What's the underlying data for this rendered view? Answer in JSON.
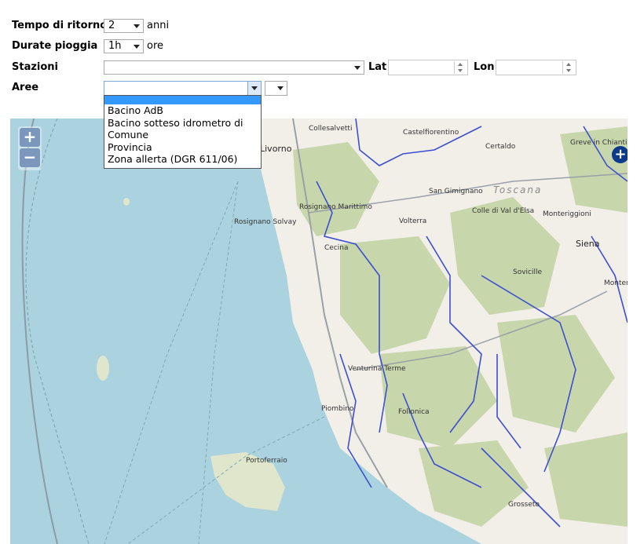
{
  "form": {
    "tempo_label": "Tempo di ritorno",
    "tempo_value": "2",
    "tempo_unit": "anni",
    "durate_label": "Durate pioggia",
    "durate_value": "1h",
    "durate_unit": "ore",
    "stazioni_label": "Stazioni",
    "stazioni_value": "",
    "lat_label": "Lat",
    "lat_value": "",
    "lon_label": "Lon",
    "lon_value": "",
    "aree_label": "Aree",
    "aree_value": "",
    "aree_sub_value": ""
  },
  "aree_dropdown": {
    "options": [
      "",
      "Bacino AdB",
      "Bacino sotteso idrometro di",
      "Comune",
      "Provincia",
      "Zona allerta (DGR 611/06)"
    ]
  },
  "map": {
    "zoom_in": "+",
    "zoom_out": "−",
    "layer_switcher": "+",
    "region_label": "Toscana",
    "towns": {
      "collesalvetti": "Collesalvetti",
      "castelfiorentino": "Castelfiorentino",
      "certaldo": "Certaldo",
      "greve": "Greve in Chianti",
      "livorno": "Livorno",
      "san_gimignano": "San Gimignano",
      "rosignano_marittimo": "Rosignano Marittimo",
      "rosignano_solvay": "Rosignano Solvay",
      "volterra": "Volterra",
      "colle": "Colle di Val d'Elsa",
      "monteriggioni": "Monteriggioni",
      "siena": "Siena",
      "cecina": "Cecina",
      "sovicille": "Sovicille",
      "monte": "Monter",
      "venturina": "Venturina Terme",
      "piombino": "Piombino",
      "follonica": "Follonica",
      "portoferraio": "Portoferraio",
      "grosseto": "Grosseto"
    },
    "colors": {
      "sea": "#aad3df",
      "land": "#f2efe9",
      "forest": "#c8d7ab",
      "river": "#3c4fd1",
      "road": "#9aa0a6"
    }
  }
}
